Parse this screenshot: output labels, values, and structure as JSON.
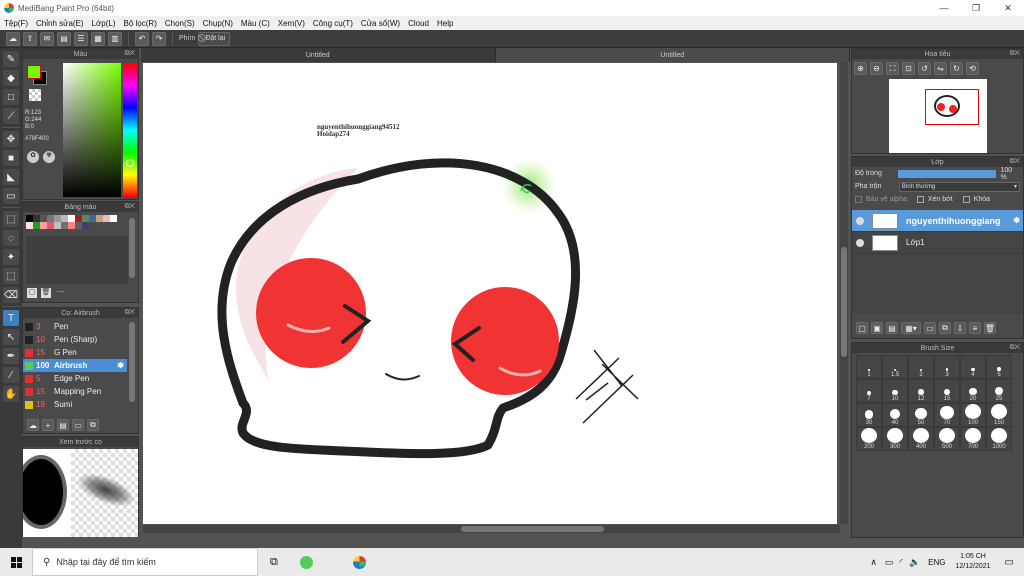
{
  "window": {
    "title": "MediBang Paint Pro (64bit)",
    "minimize": "—",
    "maximize": "❐",
    "close": "✕"
  },
  "menu": [
    "Tệp(F)",
    "Chỉnh sửa(E)",
    "Lớp(L)",
    "Bộ lọc(R)",
    "Chọn(S)",
    "Chụp(N)",
    "Màu (C)",
    "Xem(V)",
    "Công cụ(T)",
    "Cửa sổ(W)",
    "Cloud",
    "Help"
  ],
  "toolbar": {
    "shortcut_label": "Phím",
    "reset_label": "Đặt lại"
  },
  "tabs": [
    "Untitled",
    "Untitled"
  ],
  "color_panel": {
    "title": "Màu",
    "r": "R:123",
    "g": "G:244",
    "b": "B:0",
    "hex": "#78F400",
    "fg_color": "#7bf400",
    "bg_color": "#000000"
  },
  "palette_panel": {
    "title": "Bảng màu",
    "status": "---",
    "colors": [
      "#000000",
      "#333333",
      "#555555",
      "#777777",
      "#999999",
      "#bbbbbb",
      "#ffffff",
      "#a02020",
      "#5a8a5a",
      "#3a6a9a",
      "#c9a07a",
      "#e0c0c0",
      "#ffffff",
      "#ffe0e0",
      "#20a020",
      "#ffa0a0",
      "#e06060",
      "#c0c0c0",
      "#707070",
      "#ff8080",
      "#606060",
      "#404070"
    ]
  },
  "brush_panel": {
    "title": "Cọ: Airbrush",
    "items": [
      {
        "size": "3",
        "name": "Pen",
        "color": "#222222"
      },
      {
        "size": "10",
        "name": "Pen (Sharp)",
        "color": "#222222"
      },
      {
        "size": "15",
        "name": "G Pen",
        "color": "#e03030"
      },
      {
        "size": "100",
        "name": "Airbrush",
        "color": "#5ac85a",
        "selected": true
      },
      {
        "size": "5",
        "name": "Edge Pen",
        "color": "#e03030"
      },
      {
        "size": "15",
        "name": "Mapping Pen",
        "color": "#e03030"
      },
      {
        "size": "19",
        "name": "Sumi",
        "color": "#e0c020"
      }
    ]
  },
  "preview_panel": {
    "title": "Xem trước cọ"
  },
  "canvas": {
    "watermark_line1": "nguyenthihuonggiang94512",
    "watermark_line2": "Hoidap274"
  },
  "navigator_panel": {
    "title": "Hoa tiêu"
  },
  "layer_panel": {
    "title": "Lớp",
    "opacity_label": "Độ trong",
    "opacity_value": "100 %",
    "opacity": 1.0,
    "blend_label": "Pha trộn",
    "blend_value": "Bình thường",
    "protect_alpha": "Bảo vệ alpha",
    "clipping": "Xén bớt",
    "lock": "Khóa",
    "layers": [
      {
        "name": "nguyenthihuonggiang",
        "selected": true
      },
      {
        "name": "Lớp1",
        "selected": false
      }
    ]
  },
  "brush_size_panel": {
    "title": "Brush Size",
    "sizes": [
      "1",
      "1.5",
      "2",
      "3",
      "4",
      "5",
      "7",
      "10",
      "12",
      "15",
      "20",
      "25",
      "30",
      "40",
      "50",
      "70",
      "100",
      "150",
      "200",
      "300",
      "400",
      "500",
      "700",
      "1000"
    ]
  },
  "taskbar": {
    "search_placeholder": "Nhập tại đây để tìm kiếm",
    "lang": "ENG",
    "time": "1:05 CH",
    "date": "12/12/2021"
  }
}
